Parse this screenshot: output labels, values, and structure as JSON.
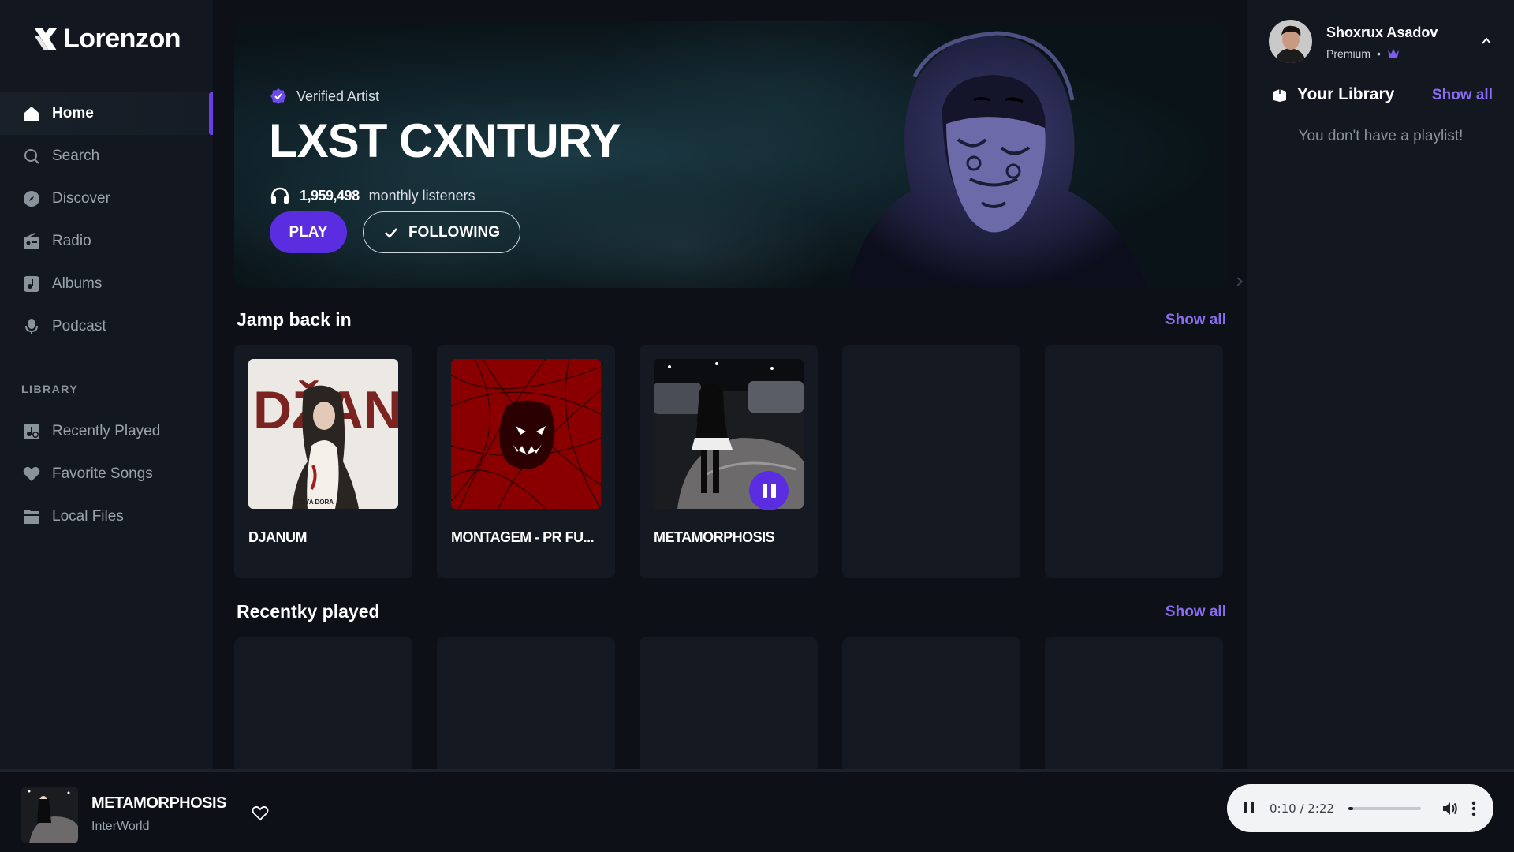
{
  "app": {
    "name": "Lorenzon"
  },
  "sidebar": {
    "nav": [
      {
        "label": "Home",
        "icon": "home-icon",
        "active": true
      },
      {
        "label": "Search",
        "icon": "search-icon"
      },
      {
        "label": "Discover",
        "icon": "compass-icon"
      },
      {
        "label": "Radio",
        "icon": "radio-icon"
      },
      {
        "label": "Albums",
        "icon": "album-icon"
      },
      {
        "label": "Podcast",
        "icon": "microphone-icon"
      }
    ],
    "library_heading": "LIBRARY",
    "library": [
      {
        "label": "Recently Played",
        "icon": "recent-music-icon"
      },
      {
        "label": "Favorite Songs",
        "icon": "heart-icon"
      },
      {
        "label": "Local Files",
        "icon": "folder-icon"
      }
    ]
  },
  "hero": {
    "badge": "Verified Artist",
    "artist": "LXST CXNTURY",
    "listeners_count": "1,959,498",
    "listeners_label": "monthly listeners",
    "play_label": "PLAY",
    "follow_label": "FOLLOWING"
  },
  "jump_back": {
    "title": "Jamp back in",
    "show_all": "Show all",
    "cards": [
      {
        "title": "DJANUM",
        "art_text": "DŽANUM",
        "art_sub": "TEYA DORA"
      },
      {
        "title": "MONTAGEM - PR FU..."
      },
      {
        "title": "METAMORPHOSIS",
        "playing": true
      }
    ]
  },
  "recently": {
    "title": "Recentky played",
    "show_all": "Show all"
  },
  "user": {
    "name": "Shoxrux Asadov",
    "plan": "Premium",
    "separator": "•"
  },
  "library": {
    "title": "Your Library",
    "show_all": "Show all",
    "empty": "You don't have a playlist!"
  },
  "player": {
    "title": "METAMORPHOSIS",
    "artist": "InterWorld",
    "time": "0:10 / 2:22",
    "progress": 0.07,
    "colors": {
      "accent": "#5b2de0",
      "link": "#8b6cf2"
    }
  }
}
